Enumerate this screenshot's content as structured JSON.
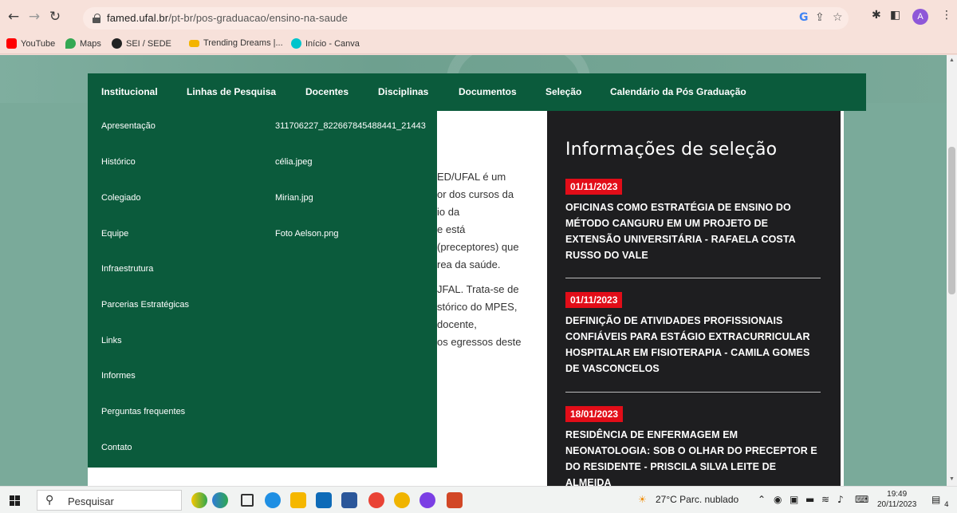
{
  "browser": {
    "url_domain": "famed.ufal.br",
    "url_path": "/pt-br/pos-graduacao/ensino-na-saude",
    "avatar_letter": "A",
    "bookmarks": [
      {
        "label": "YouTube",
        "color": "#ff0000"
      },
      {
        "label": "Maps",
        "color": "#34a853"
      },
      {
        "label": "SEI / SEDE",
        "color": "#222222"
      },
      {
        "label": "Trending Dreams |...",
        "color": "#f4b400"
      },
      {
        "label": "Início - Canva",
        "color": "#00c4cc"
      }
    ]
  },
  "navbar": {
    "items": [
      {
        "label": "Institucional"
      },
      {
        "label": "Linhas de Pesquisa"
      },
      {
        "label": "Docentes"
      },
      {
        "label": "Disciplinas"
      },
      {
        "label": "Documentos"
      },
      {
        "label": "Seleção"
      },
      {
        "label": "Calendário da Pós Graduação"
      }
    ]
  },
  "dropdown": {
    "items": [
      {
        "label": "Apresentação"
      },
      {
        "label": "Histórico"
      },
      {
        "label": "Colegiado"
      },
      {
        "label": "Equipe"
      },
      {
        "label": "Infraestrutura"
      },
      {
        "label": "Parcerias Estratégicas"
      },
      {
        "label": "Links"
      },
      {
        "label": "Informes"
      },
      {
        "label": "Perguntas frequentes"
      },
      {
        "label": "Contato"
      }
    ],
    "files": [
      {
        "label": "311706227_822667845488441_21443"
      },
      {
        "label": "célia.jpeg"
      },
      {
        "label": "Mirian.jpg"
      },
      {
        "label": "Foto Aelson.png"
      }
    ]
  },
  "body_fragments": [
    "ED/UFAL é um",
    "or dos cursos da",
    "io da",
    "e está",
    "(preceptores) que",
    "rea da saúde.",
    "JFAL. Trata-se de",
    "stórico do MPES,",
    "docente,",
    "os egressos deste"
  ],
  "sidebar": {
    "title": "Informações de seleção",
    "news": [
      {
        "date": "01/11/2023",
        "title": "OFICINAS COMO ESTRATÉGIA DE ENSINO DO MÉTODO CANGURU EM UM PROJETO DE EXTENSÃO UNIVERSITÁRIA - RAFAELA COSTA RUSSO DO VALE"
      },
      {
        "date": "01/11/2023",
        "title": "DEFINIÇÃO DE ATIVIDADES PROFISSIONAIS CONFIÁVEIS PARA ESTÁGIO EXTRACURRICULAR HOSPITALAR EM FISIOTERAPIA - CAMILA GOMES DE VASCONCELOS"
      },
      {
        "date": "18/01/2023",
        "title": "RESIDÊNCIA DE ENFERMAGEM EM NEONATOLOGIA: SOB O OLHAR DO PRECEPTOR E DO RESIDENTE - PRISCILA SILVA LEITE DE ALMEIDA"
      }
    ],
    "date_color": "#e20d18"
  },
  "taskbar": {
    "search_label": "Pesquisar",
    "weather": "27°C  Parc. nublado",
    "time": "19:49",
    "date": "20/11/2023",
    "notification_count": "4"
  },
  "colors": {
    "nav_green": "#0b5b3c",
    "sidebar_dark": "#1e1e20"
  }
}
